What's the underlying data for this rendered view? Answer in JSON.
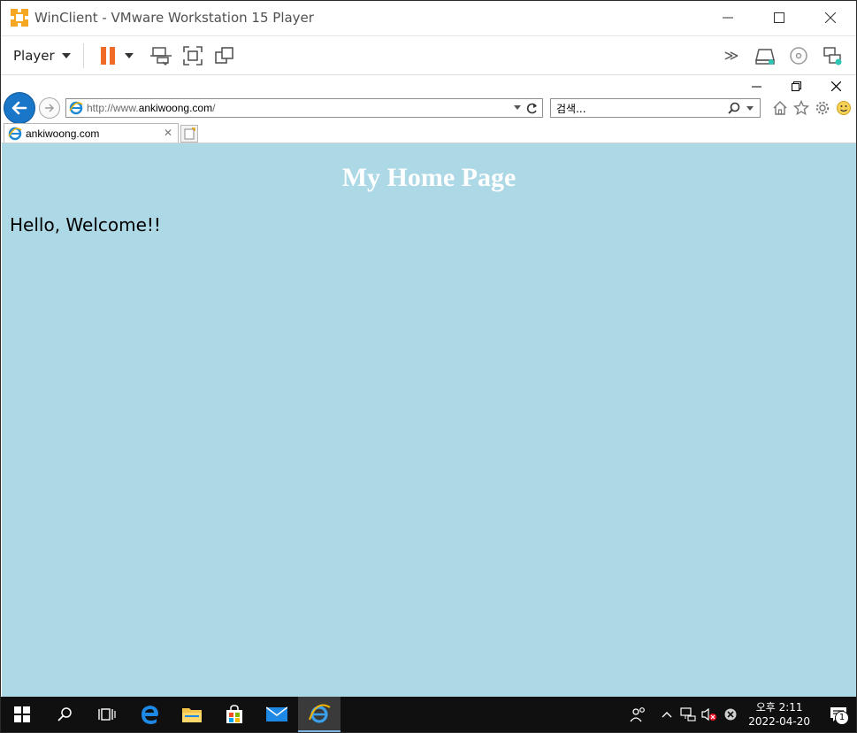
{
  "vm": {
    "title": "WinClient - VMware Workstation 15 Player",
    "menu_label": "Player",
    "colors": {
      "pause_orange": "#f06a28",
      "accent_teal": "#2ec4b6"
    }
  },
  "browser": {
    "address_prefix": "http://www.",
    "address_domain": "ankiwoong.com",
    "address_suffix": "/",
    "search_placeholder": "검색...",
    "tab_title": "ankiwoong.com"
  },
  "page": {
    "background": "#add8e6",
    "heading": "My Home Page",
    "paragraph": "Hello, Welcome!!"
  },
  "taskbar": {
    "clock_time": "오후 2:11",
    "clock_date": "2022-04-20",
    "notification_count": "1"
  }
}
